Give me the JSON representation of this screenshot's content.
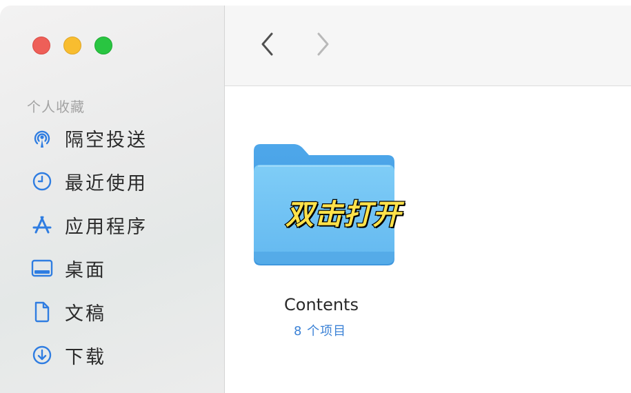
{
  "window": {
    "controls": {
      "close": "close",
      "minimize": "minimize",
      "zoom": "zoom"
    }
  },
  "toolbar": {
    "back_icon": "chevron-left-icon",
    "forward_icon": "chevron-right-icon"
  },
  "sidebar": {
    "section_title": "个人收藏",
    "items": [
      {
        "label": "隔空投送",
        "icon": "airdrop-icon"
      },
      {
        "label": "最近使用",
        "icon": "clock-icon"
      },
      {
        "label": "应用程序",
        "icon": "applications-icon"
      },
      {
        "label": "桌面",
        "icon": "desktop-icon"
      },
      {
        "label": "文稿",
        "icon": "document-icon"
      },
      {
        "label": "下载",
        "icon": "download-icon"
      }
    ],
    "icon_color": "#2f7de1"
  },
  "content": {
    "folder": {
      "name": "Contents",
      "item_count": "8 个项目",
      "overlay": "双击打开",
      "color": "#6ec3f4"
    }
  }
}
